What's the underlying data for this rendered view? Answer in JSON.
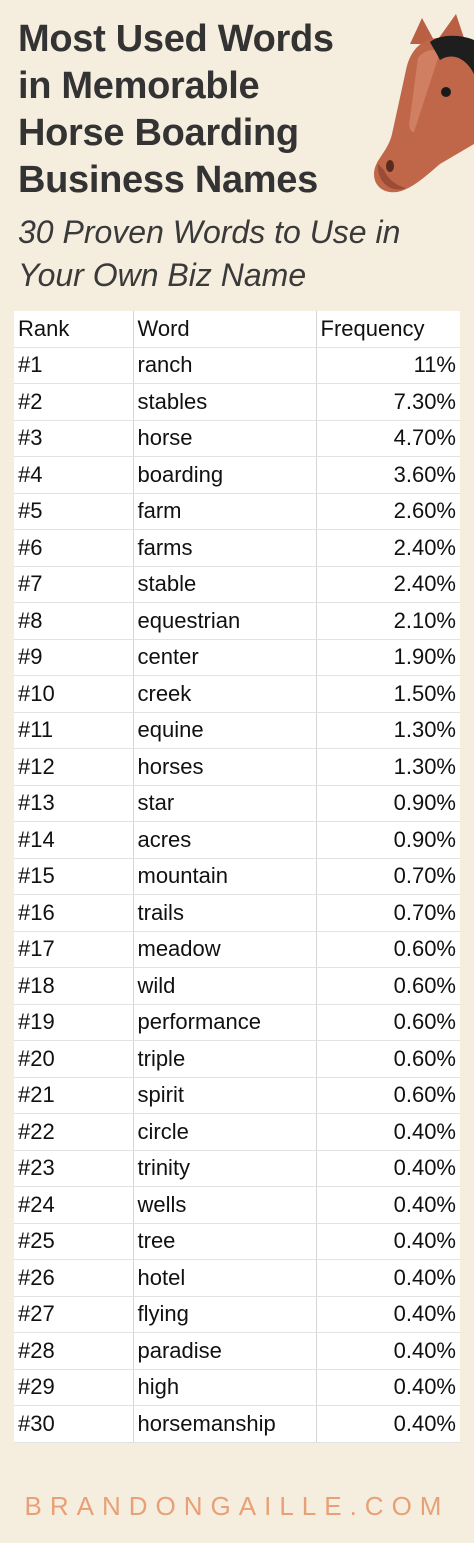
{
  "title": {
    "lines": [
      "Most Used Words",
      "in Memorable",
      "Horse Boarding",
      "Business Names"
    ]
  },
  "subtitle": {
    "lines": [
      "30 Proven Words to Use in",
      "Your Own Biz Name"
    ]
  },
  "illustration": {
    "icon": "horse-head-icon",
    "color": "#c0674a"
  },
  "table": {
    "headers": {
      "rank": "Rank",
      "word": "Word",
      "frequency": "Frequency"
    },
    "rows": [
      {
        "rank": "#1",
        "word": "ranch",
        "frequency": "11%"
      },
      {
        "rank": "#2",
        "word": "stables",
        "frequency": "7.30%"
      },
      {
        "rank": "#3",
        "word": "horse",
        "frequency": "4.70%"
      },
      {
        "rank": "#4",
        "word": "boarding",
        "frequency": "3.60%"
      },
      {
        "rank": "#5",
        "word": "farm",
        "frequency": "2.60%"
      },
      {
        "rank": "#6",
        "word": "farms",
        "frequency": "2.40%"
      },
      {
        "rank": "#7",
        "word": "stable",
        "frequency": "2.40%"
      },
      {
        "rank": "#8",
        "word": "equestrian",
        "frequency": "2.10%"
      },
      {
        "rank": "#9",
        "word": "center",
        "frequency": "1.90%"
      },
      {
        "rank": "#10",
        "word": "creek",
        "frequency": "1.50%"
      },
      {
        "rank": "#11",
        "word": "equine",
        "frequency": "1.30%"
      },
      {
        "rank": "#12",
        "word": "horses",
        "frequency": "1.30%"
      },
      {
        "rank": "#13",
        "word": "star",
        "frequency": "0.90%"
      },
      {
        "rank": "#14",
        "word": "acres",
        "frequency": "0.90%"
      },
      {
        "rank": "#15",
        "word": "mountain",
        "frequency": "0.70%"
      },
      {
        "rank": "#16",
        "word": "trails",
        "frequency": "0.70%"
      },
      {
        "rank": "#17",
        "word": "meadow",
        "frequency": "0.60%"
      },
      {
        "rank": "#18",
        "word": "wild",
        "frequency": "0.60%"
      },
      {
        "rank": "#19",
        "word": "performance",
        "frequency": "0.60%"
      },
      {
        "rank": "#20",
        "word": "triple",
        "frequency": "0.60%"
      },
      {
        "rank": "#21",
        "word": "spirit",
        "frequency": "0.60%"
      },
      {
        "rank": "#22",
        "word": "circle",
        "frequency": "0.40%"
      },
      {
        "rank": "#23",
        "word": "trinity",
        "frequency": "0.40%"
      },
      {
        "rank": "#24",
        "word": "wells",
        "frequency": "0.40%"
      },
      {
        "rank": "#25",
        "word": "tree",
        "frequency": "0.40%"
      },
      {
        "rank": "#26",
        "word": "hotel",
        "frequency": "0.40%"
      },
      {
        "rank": "#27",
        "word": "flying",
        "frequency": "0.40%"
      },
      {
        "rank": "#28",
        "word": "paradise",
        "frequency": "0.40%"
      },
      {
        "rank": "#29",
        "word": "high",
        "frequency": "0.40%"
      },
      {
        "rank": "#30",
        "word": "horsemanship",
        "frequency": "0.40%"
      }
    ]
  },
  "footer": {
    "text": "BRANDONGAILLE.COM",
    "color": "#e8a176"
  },
  "colors": {
    "background": "#f5eedf",
    "title": "#333333",
    "accent": "#c0674a"
  }
}
